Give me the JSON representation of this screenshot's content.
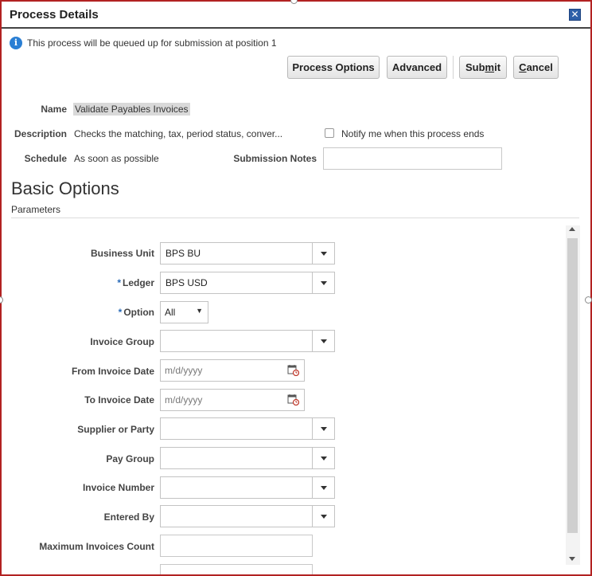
{
  "dialog": {
    "title": "Process Details"
  },
  "info": {
    "text": "This process will be queued up for submission at position 1"
  },
  "buttons": {
    "process_options": "Process Options",
    "advanced": "Advanced",
    "submit_pre": "Sub",
    "submit_u": "m",
    "submit_post": "it",
    "cancel_u": "C",
    "cancel_post": "ancel"
  },
  "details": {
    "name_label": "Name",
    "name_value": "Validate Payables Invoices",
    "description_label": "Description",
    "description_value": "Checks the matching, tax, period status, conver...",
    "schedule_label": "Schedule",
    "schedule_value": "As soon as possible",
    "notify_label": "Notify me when this process ends",
    "notify_checked": false,
    "submission_notes_label": "Submission Notes",
    "submission_notes_value": ""
  },
  "section": {
    "title": "Basic Options",
    "subtitle": "Parameters"
  },
  "parameters": {
    "business_unit": {
      "label": "Business Unit",
      "value": "BPS BU"
    },
    "ledger": {
      "label": "Ledger",
      "value": "BPS USD",
      "required": "*"
    },
    "option": {
      "label": "Option",
      "value": "All",
      "required": "*"
    },
    "invoice_group": {
      "label": "Invoice Group",
      "value": ""
    },
    "from_invoice_date": {
      "label": "From Invoice Date",
      "placeholder": "m/d/yyyy"
    },
    "to_invoice_date": {
      "label": "To Invoice Date",
      "placeholder": "m/d/yyyy"
    },
    "supplier_or_party": {
      "label": "Supplier or Party",
      "value": ""
    },
    "pay_group": {
      "label": "Pay Group",
      "value": ""
    },
    "invoice_number": {
      "label": "Invoice Number",
      "value": ""
    },
    "entered_by": {
      "label": "Entered By",
      "value": ""
    },
    "max_invoices_count": {
      "label": "Maximum Invoices Count",
      "value": ""
    }
  },
  "colors": {
    "border": "#b22222",
    "accent": "#2a7fd4",
    "required": "#2a6bb8"
  }
}
